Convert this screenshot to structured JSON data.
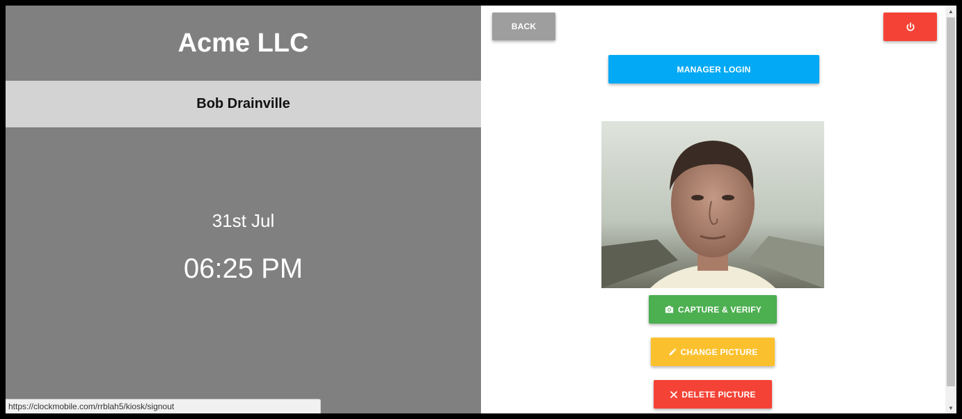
{
  "left_panel": {
    "company": "Acme LLC",
    "employee": "Bob Drainville",
    "date": "31st Jul",
    "time": "06:25 PM"
  },
  "status_bar": {
    "url": "https://clockmobile.com/rrblah5/kiosk/signout"
  },
  "right_panel": {
    "back_label": "BACK",
    "power_icon": "power-icon",
    "manager_login_label": "MANAGER LOGIN",
    "photo_alt": "employee photo",
    "capture_label": "CAPTURE & VERIFY",
    "capture_icon": "camera-icon",
    "change_label": "CHANGE PICTURE",
    "change_icon": "pencil-icon",
    "delete_label": "DELETE PICTURE",
    "delete_icon": "close-icon"
  },
  "colors": {
    "left_bg": "#808080",
    "employee_bar": "#d3d3d3",
    "back": "#9e9e9e",
    "power": "#f44336",
    "manager_login": "#03a9f4",
    "capture": "#4caf50",
    "change": "#fbc02d",
    "delete": "#f44336"
  }
}
